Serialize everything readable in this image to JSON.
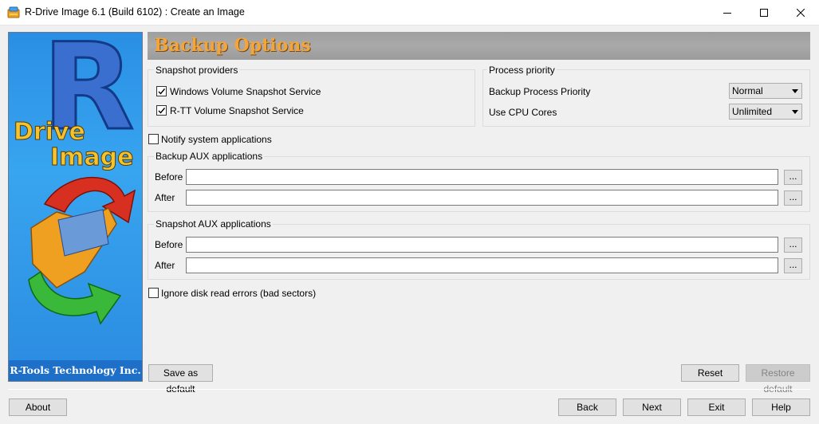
{
  "window": {
    "title": "R-Drive Image 6.1 (Build 6102) : Create an Image"
  },
  "banner": {
    "logo_letter": "R",
    "logo_line1": "Drive",
    "logo_line2": "Image",
    "footer": "R-Tools Technology Inc."
  },
  "header": {
    "title": "Backup Options"
  },
  "snapshot_providers": {
    "title": "Snapshot providers",
    "items": [
      {
        "label": "Windows Volume Snapshot Service",
        "checked": true
      },
      {
        "label": "R-TT Volume Snapshot Service",
        "checked": true
      }
    ]
  },
  "process_priority": {
    "title": "Process priority",
    "backup_priority_label": "Backup Process Priority",
    "backup_priority_value": "Normal",
    "cpu_cores_label": "Use CPU Cores",
    "cpu_cores_value": "Unlimited"
  },
  "notify": {
    "label": "Notify system applications",
    "checked": false
  },
  "backup_aux": {
    "title": "Backup AUX applications",
    "before_label": "Before",
    "before_value": "",
    "after_label": "After",
    "after_value": "",
    "browse": "..."
  },
  "snapshot_aux": {
    "title": "Snapshot AUX applications",
    "before_label": "Before",
    "before_value": "",
    "after_label": "After",
    "after_value": "",
    "browse": "..."
  },
  "ignore_errors": {
    "label": "Ignore disk read errors (bad sectors)",
    "checked": false
  },
  "buttons": {
    "save_default": "Save as default",
    "reset": "Reset",
    "restore_default": "Restore default",
    "about": "About",
    "back": "Back",
    "next": "Next",
    "exit": "Exit",
    "help": "Help"
  }
}
